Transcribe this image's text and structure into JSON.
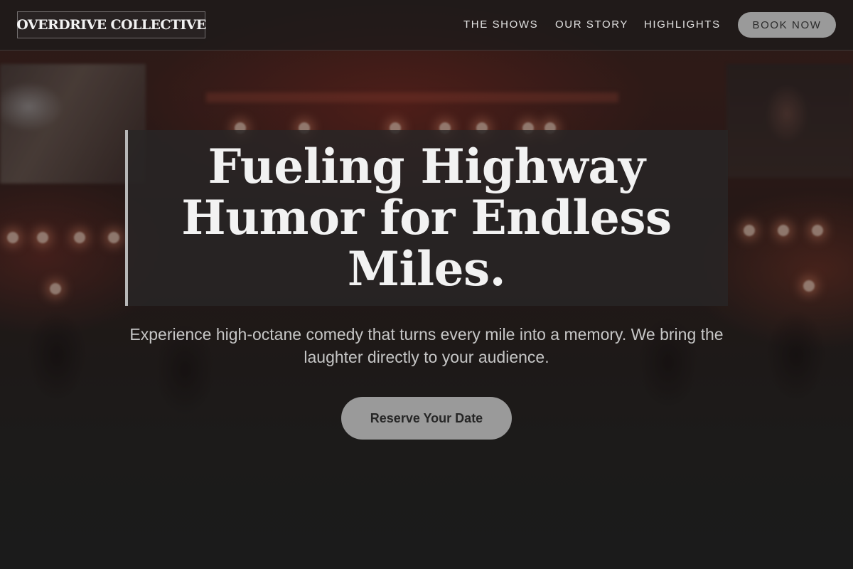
{
  "brand": {
    "name": "OVERDRIVE COLLECTIVE"
  },
  "nav": {
    "items": [
      {
        "label": "THE SHOWS"
      },
      {
        "label": "OUR STORY"
      },
      {
        "label": "HIGHLIGHTS"
      }
    ],
    "cta_label": "BOOK NOW"
  },
  "hero": {
    "headline": "Fueling Highway Humor for Endless Miles.",
    "subtitle": "Experience high-octane comedy that turns every mile into a memory. We bring the laughter directly to your audience.",
    "cta_label": "Reserve Your Date"
  },
  "colors": {
    "page_background": "#1f1f1f",
    "button_fill": "#9a9a9a",
    "headline_text": "#f2f2f2",
    "accent_bar": "#b8b8b8"
  }
}
